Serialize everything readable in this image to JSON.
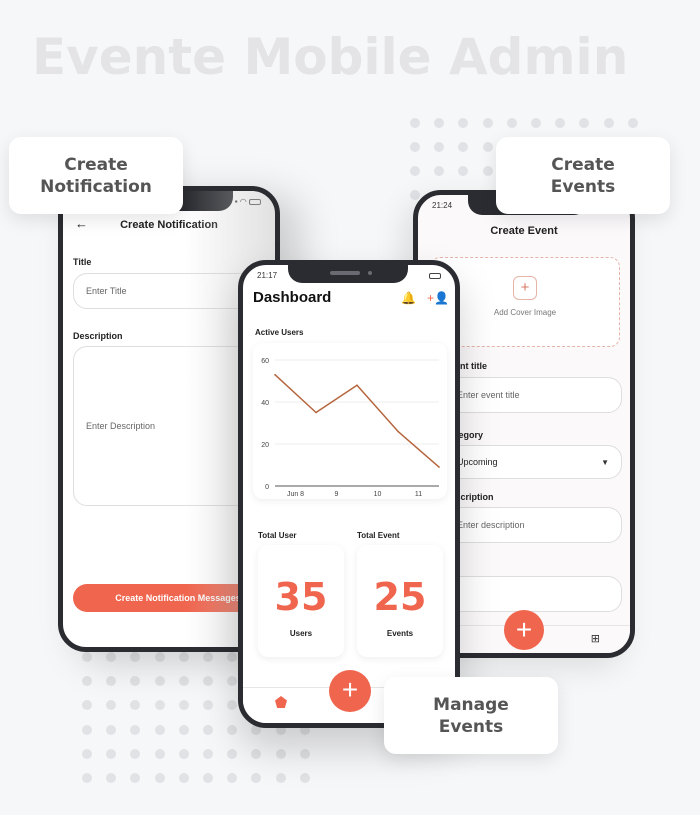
{
  "hero": {
    "title": "Evente Mobile Admin"
  },
  "callouts": {
    "create_notification": "Create\nNotification",
    "create_events": "Create\nEvents",
    "manage_events": "Manage\nEvents"
  },
  "create_notification_screen": {
    "title": "Create Notification",
    "back_icon": "arrow-left-icon",
    "title_label": "Title",
    "title_placeholder": "Enter Title",
    "description_label": "Description",
    "description_placeholder": "Enter Description",
    "submit_label": "Create Notification Messages"
  },
  "dashboard_screen": {
    "status_time": "21:17",
    "title": "Dashboard",
    "icons": [
      "bell-add-icon",
      "add-user-icon"
    ],
    "active_users_label": "Active Users",
    "total_user_label": "Total User",
    "total_event_label": "Total Event",
    "total_users": "35",
    "users_caption": "Users",
    "total_events": "25",
    "events_caption": "Events",
    "fab_label": "+",
    "nav_icon": "home-pentagon-icon"
  },
  "create_event_screen": {
    "status_time": "21:24",
    "title": "Create Event",
    "cover_plus": "+",
    "cover_label": "Add Cover Image",
    "event_title_label": "Event title",
    "event_title_placeholder": "Enter event title",
    "category_label": "Category",
    "category_value": "Upcoming",
    "description_label": "Description",
    "description_placeholder": "Enter description",
    "fab_label": "+",
    "nav_icon": "add-bookmark-icon"
  },
  "chart_data": {
    "type": "line",
    "title": "Active Users",
    "x": [
      "Jun 8",
      "",
      "9",
      "",
      "10",
      "",
      "11",
      ""
    ],
    "categories": [
      "Jun 7.5",
      "Jun 8.5",
      "Jun 9.5",
      "Jun 10.5",
      "Jun 11.5"
    ],
    "tick_labels_x": [
      "Jun 8",
      "9",
      "10",
      "11"
    ],
    "tick_labels_y": [
      "0",
      "20",
      "40",
      "60"
    ],
    "values": [
      53,
      35,
      48,
      26,
      9
    ],
    "ylim": [
      0,
      60
    ],
    "grid": true,
    "line_color": "#b5663f"
  }
}
